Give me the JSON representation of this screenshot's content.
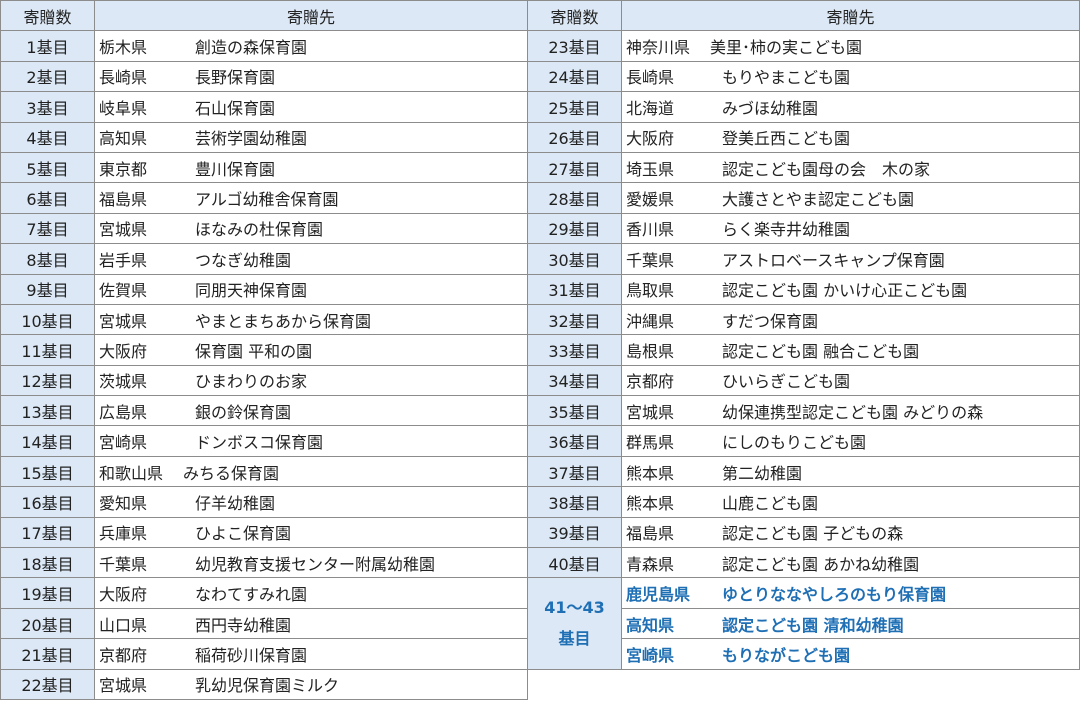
{
  "header": {
    "count_label": "寄贈数",
    "dest_label": "寄贈先"
  },
  "left_rows": [
    {
      "num": "1基目",
      "pref": "栃木県",
      "name": "創造の森保育園"
    },
    {
      "num": "2基目",
      "pref": "長崎県",
      "name": "長野保育園"
    },
    {
      "num": "3基目",
      "pref": "岐阜県",
      "name": "石山保育園"
    },
    {
      "num": "4基目",
      "pref": "高知県",
      "name": "芸術学園幼稚園"
    },
    {
      "num": "5基目",
      "pref": "東京都",
      "name": "豊川保育園"
    },
    {
      "num": "6基目",
      "pref": "福島県",
      "name": "アルゴ幼稚舎保育園"
    },
    {
      "num": "7基目",
      "pref": "宮城県",
      "name": "ほなみの杜保育園"
    },
    {
      "num": "8基目",
      "pref": "岩手県",
      "name": "つなぎ幼稚園"
    },
    {
      "num": "9基目",
      "pref": "佐賀県",
      "name": "同朋天神保育園"
    },
    {
      "num": "10基目",
      "pref": "宮城県",
      "name": "やまとまちあから保育園"
    },
    {
      "num": "11基目",
      "pref": "大阪府",
      "name": "保育園 平和の園"
    },
    {
      "num": "12基目",
      "pref": "茨城県",
      "name": "ひまわりのお家"
    },
    {
      "num": "13基目",
      "pref": "広島県",
      "name": "銀の鈴保育園"
    },
    {
      "num": "14基目",
      "pref": "宮崎県",
      "name": "ドンボスコ保育園"
    },
    {
      "num": "15基目",
      "pref": "和歌山県",
      "name": "みちる保育園"
    },
    {
      "num": "16基目",
      "pref": "愛知県",
      "name": "仔羊幼稚園"
    },
    {
      "num": "17基目",
      "pref": "兵庫県",
      "name": "ひよこ保育園"
    },
    {
      "num": "18基目",
      "pref": "千葉県",
      "name": "幼児教育支援センター附属幼稚園"
    },
    {
      "num": "19基目",
      "pref": "大阪府",
      "name": "なわてすみれ園"
    },
    {
      "num": "20基目",
      "pref": "山口県",
      "name": "西円寺幼稚園"
    },
    {
      "num": "21基目",
      "pref": "京都府",
      "name": "稲荷砂川保育園"
    },
    {
      "num": "22基目",
      "pref": "宮城県",
      "name": "乳幼児保育園ミルク"
    }
  ],
  "right_rows": [
    {
      "num": "23基目",
      "pref": "神奈川県",
      "name": "美里･柿の実こども園"
    },
    {
      "num": "24基目",
      "pref": "長崎県",
      "name": "もりやまこども園"
    },
    {
      "num": "25基目",
      "pref": "北海道",
      "name": "みづほ幼稚園"
    },
    {
      "num": "26基目",
      "pref": "大阪府",
      "name": "登美丘西こども園"
    },
    {
      "num": "27基目",
      "pref": "埼玉県",
      "name": "認定こども園母の会　木の家"
    },
    {
      "num": "28基目",
      "pref": "愛媛県",
      "name": "大護さとやま認定こども園"
    },
    {
      "num": "29基目",
      "pref": "香川県",
      "name": "らく楽寺井幼稚園"
    },
    {
      "num": "30基目",
      "pref": "千葉県",
      "name": "アストロベースキャンプ保育園"
    },
    {
      "num": "31基目",
      "pref": "鳥取県",
      "name": "認定こども園 かいけ心正こども園"
    },
    {
      "num": "32基目",
      "pref": "沖縄県",
      "name": "すだつ保育園"
    },
    {
      "num": "33基目",
      "pref": "島根県",
      "name": "認定こども園 融合こども園"
    },
    {
      "num": "34基目",
      "pref": "京都府",
      "name": "ひいらぎこども園"
    },
    {
      "num": "35基目",
      "pref": "宮城県",
      "name": "幼保連携型認定こども園 みどりの森"
    },
    {
      "num": "36基目",
      "pref": "群馬県",
      "name": "にしのもりこども園"
    },
    {
      "num": "37基目",
      "pref": "熊本県",
      "name": "第二幼稚園"
    },
    {
      "num": "38基目",
      "pref": "熊本県",
      "name": "山鹿こども園"
    },
    {
      "num": "39基目",
      "pref": "福島県",
      "name": "認定こども園 子どもの森"
    },
    {
      "num": "40基目",
      "pref": "青森県",
      "name": "認定こども園 あかね幼稚園"
    }
  ],
  "highlight_group": {
    "num_line1": "41～43",
    "num_line2": "基目",
    "rows": [
      {
        "pref": "鹿児島県",
        "name": "ゆとりななやしろのもり保育園"
      },
      {
        "pref": "高知県",
        "name": "認定こども園 清和幼稚園"
      },
      {
        "pref": "宮崎県",
        "name": "もりながこども園"
      }
    ],
    "color": "#1f6fb5"
  },
  "colors": {
    "header_bg": "#dce8f5",
    "border": "#8c8c8c"
  }
}
